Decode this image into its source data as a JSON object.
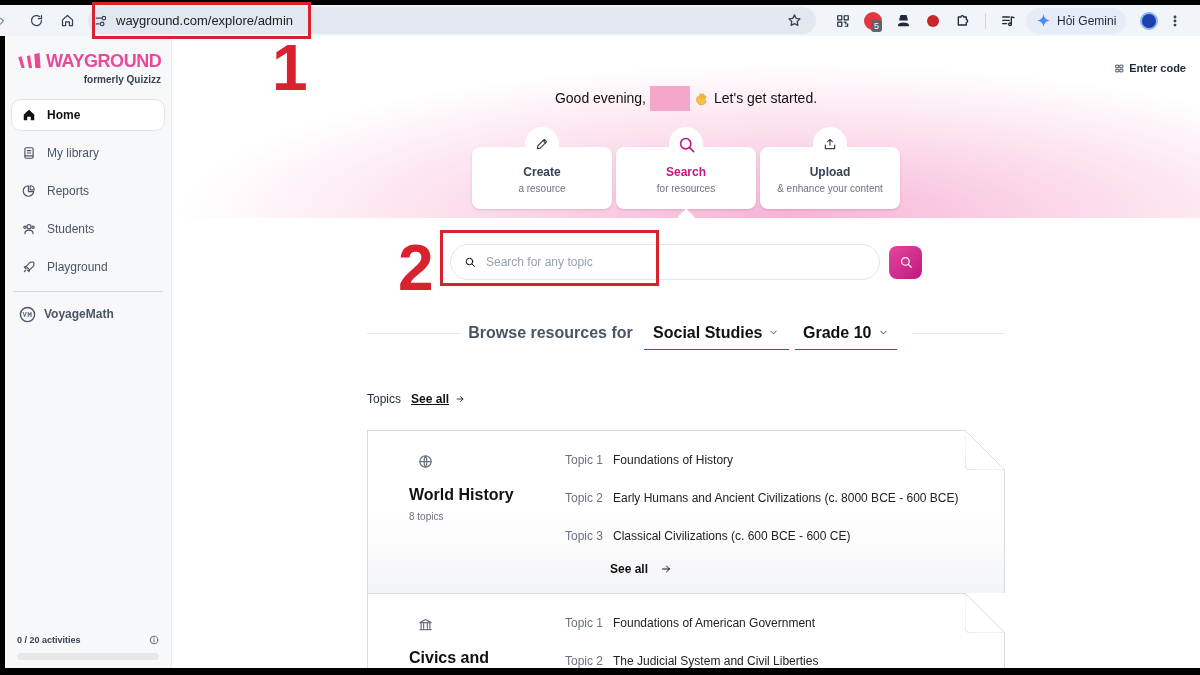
{
  "browser": {
    "url": "wayground.com/explore/admin",
    "extension_badge": "5",
    "gemini_button": "Hỏi Gemini"
  },
  "annotations": [
    {
      "label": "1"
    },
    {
      "label": "2"
    }
  ],
  "sidebar": {
    "logo": "WAYGROUND",
    "logo_subtitle": "formerly Quizizz",
    "items": [
      {
        "label": "Home",
        "selected": true
      },
      {
        "label": "My library",
        "selected": false
      },
      {
        "label": "Reports",
        "selected": false
      },
      {
        "label": "Students",
        "selected": false
      },
      {
        "label": "Playground",
        "selected": false
      }
    ],
    "voyage": "VoyageMath",
    "usage": {
      "label": "0 / 20 activities",
      "level": 0
    }
  },
  "header": {
    "enter_code": "Enter code",
    "greeting": "Good evening,",
    "greeting_end": "Let's get started."
  },
  "actions": [
    {
      "title": "Create",
      "subtitle": "a resource",
      "selected": false
    },
    {
      "title": "Search",
      "subtitle": "for resources",
      "selected": true
    },
    {
      "title": "Upload",
      "subtitle": "& enhance your content",
      "selected": false
    }
  ],
  "search": {
    "placeholder": "Search for any topic"
  },
  "browse": {
    "label": "Browse resources for",
    "subject": "Social Studies",
    "grade": "Grade 10"
  },
  "topics": {
    "label": "Topics",
    "see_all": "See all",
    "cards": [
      {
        "title": "World History",
        "count": "8 topics",
        "see_all": "See all",
        "items": [
          {
            "number": "Topic 1",
            "name": "Foundations of History"
          },
          {
            "number": "Topic 2",
            "name": "Early Humans and Ancient Civilizations (c. 8000 BCE - 600 BCE)"
          },
          {
            "number": "Topic 3",
            "name": "Classical Civilizations (c. 600 BCE - 600 CE)"
          }
        ]
      },
      {
        "title": "Civics and",
        "items": [
          {
            "number": "Topic 1",
            "name": "Foundations of American Government"
          },
          {
            "number": "Topic 2",
            "name": "The Judicial System and Civil Liberties"
          }
        ]
      }
    ]
  }
}
